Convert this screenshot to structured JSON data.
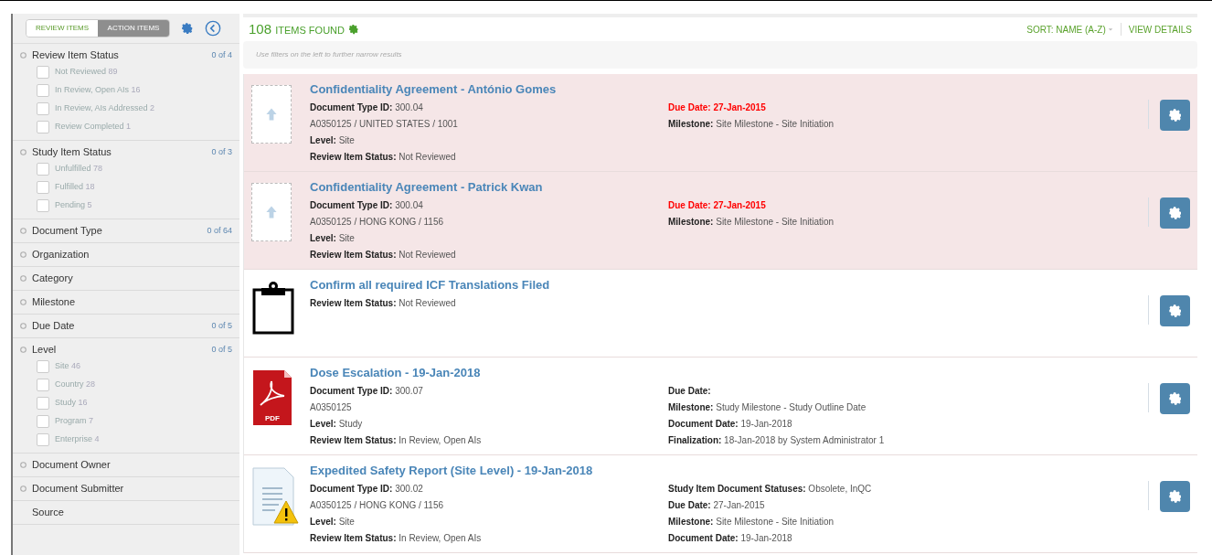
{
  "sidebar": {
    "tabs": [
      {
        "label": "REVIEW ITEMS",
        "selected": true
      },
      {
        "label": "ACTION ITEMS",
        "selected": false
      }
    ],
    "facets": [
      {
        "kind": "facet",
        "title": "Review Item Status",
        "count": "0 of 4",
        "options": [
          {
            "label": "Not Reviewed",
            "count": "89",
            "checked": false
          },
          {
            "label": "In Review, Open AIs",
            "count": "16",
            "checked": false
          },
          {
            "label": "In Review, AIs Addressed",
            "count": "2",
            "checked": false
          },
          {
            "label": "Review Completed",
            "count": "1",
            "checked": false
          }
        ]
      },
      {
        "kind": "facet",
        "title": "Study Item Status",
        "count": "0 of 3",
        "options": [
          {
            "label": "Unfulfilled",
            "count": "78",
            "checked": false
          },
          {
            "label": "Fulfilled",
            "count": "18",
            "checked": false
          },
          {
            "label": "Pending",
            "count": "5",
            "checked": false
          }
        ]
      },
      {
        "kind": "facet",
        "title": "Document Type",
        "count": "0 of 64"
      },
      {
        "kind": "facet",
        "title": "Organization"
      },
      {
        "kind": "facet",
        "title": "Category"
      },
      {
        "kind": "facet",
        "title": "Milestone"
      },
      {
        "kind": "facet",
        "title": "Due Date",
        "count": "0 of 5"
      },
      {
        "kind": "facet",
        "title": "Level",
        "count": "0 of 5",
        "options": [
          {
            "label": "Site",
            "count": "46",
            "checked": false
          },
          {
            "label": "Country",
            "count": "28",
            "checked": false
          },
          {
            "label": "Study",
            "count": "16",
            "checked": false
          },
          {
            "label": "Program",
            "count": "7",
            "checked": false
          },
          {
            "label": "Enterprise",
            "count": "4",
            "checked": false
          }
        ]
      },
      {
        "kind": "facet",
        "title": "Document Owner"
      },
      {
        "kind": "facet",
        "title": "Document Submitter"
      },
      {
        "kind": "plain",
        "title": "Source"
      }
    ]
  },
  "results": {
    "count": "108",
    "count_label": "ITEMS FOUND",
    "sort": "SORT: NAME (A-Z)",
    "view": "VIEW DETAILS",
    "hint": "Use filters on the left to further narrow results",
    "items": [
      {
        "kind": "upload",
        "overdue": true,
        "title": "Confidentiality Agreement - António Gomes",
        "left": [
          {
            "label": "Document Type ID:",
            "value": "300.04"
          },
          {
            "value": "A0350125 / UNITED STATES / 1001"
          },
          {
            "label": "Level:",
            "value": "Site"
          },
          {
            "label": "Review Item Status:",
            "value": "Not Reviewed"
          }
        ],
        "right": [
          {
            "kind": "due",
            "label": "Due Date:",
            "value": "27-Jan-2015"
          },
          {
            "kind": "plain",
            "label": "Milestone:",
            "value": "Site Milestone - Site Initiation"
          }
        ]
      },
      {
        "kind": "upload",
        "overdue": true,
        "title": "Confidentiality Agreement - Patrick Kwan",
        "left": [
          {
            "label": "Document Type ID:",
            "value": "300.04"
          },
          {
            "value": "A0350125 / HONG KONG / 1156"
          },
          {
            "label": "Level:",
            "value": "Site"
          },
          {
            "label": "Review Item Status:",
            "value": "Not Reviewed"
          }
        ],
        "right": [
          {
            "kind": "due",
            "label": "Due Date:",
            "value": "27-Jan-2015"
          },
          {
            "kind": "plain",
            "label": "Milestone:",
            "value": "Site Milestone - Site Initiation"
          }
        ]
      },
      {
        "kind": "task",
        "overdue": false,
        "title": "Confirm all required ICF Translations Filed",
        "left": [
          {
            "label": "Review Item Status:",
            "value": "Not Reviewed"
          }
        ]
      },
      {
        "kind": "pdf",
        "file_label": "PDF",
        "overdue": false,
        "title": "Dose Escalation - 19-Jan-2018",
        "left": [
          {
            "label": "Document Type ID:",
            "value": "300.07"
          },
          {
            "value": "A0350125"
          },
          {
            "label": "Level:",
            "value": "Study"
          },
          {
            "label": "Review Item Status:",
            "value": "In Review, Open AIs"
          }
        ],
        "right": [
          {
            "kind": "due",
            "label": "Due Date:"
          },
          {
            "kind": "plain",
            "label": "Milestone:",
            "value": "Study Milestone - Study Outline Date"
          },
          {
            "kind": "plain",
            "label": "Document Date:",
            "value": "19-Jan-2018"
          },
          {
            "kind": "plain",
            "label": "Finalization:",
            "value": "18-Jan-2018 by System Administrator 1"
          }
        ]
      },
      {
        "kind": "warning",
        "overdue": false,
        "title": "Expedited Safety Report (Site Level) - 19-Jan-2018",
        "left": [
          {
            "label": "Document Type ID:",
            "value": "300.02"
          },
          {
            "value": "A0350125 / HONG KONG / 1156"
          },
          {
            "label": "Level:",
            "value": "Site"
          },
          {
            "label": "Review Item Status:",
            "value": "In Review, Open AIs"
          }
        ],
        "right": [
          {
            "kind": "plain",
            "label": "Study Item Document Statuses:",
            "value": "Obsolete, InQC"
          },
          {
            "kind": "due",
            "label": "Due Date:",
            "value": "27-Jan-2015"
          },
          {
            "kind": "plain",
            "label": "Milestone:",
            "value": "Site Milestone - Site Initiation"
          },
          {
            "kind": "plain",
            "label": "Document Date:",
            "value": "19-Jan-2018"
          }
        ]
      }
    ]
  }
}
